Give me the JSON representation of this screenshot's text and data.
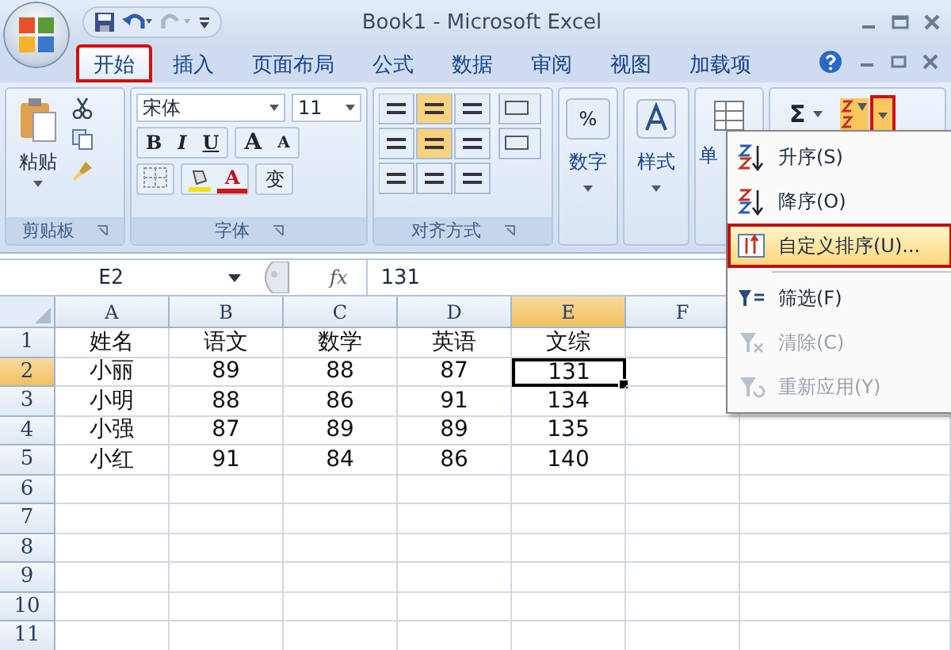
{
  "window": {
    "title": "Book1 - Microsoft Excel"
  },
  "tabs": [
    {
      "label": "开始",
      "selected": true,
      "marked": true
    },
    {
      "label": "插入",
      "selected": false,
      "marked": false
    },
    {
      "label": "页面布局",
      "selected": false,
      "marked": false
    },
    {
      "label": "公式",
      "selected": false,
      "marked": false
    },
    {
      "label": "数据",
      "selected": false,
      "marked": false
    },
    {
      "label": "审阅",
      "selected": false,
      "marked": false
    },
    {
      "label": "视图",
      "selected": false,
      "marked": false
    },
    {
      "label": "加载项",
      "selected": false,
      "marked": false
    }
  ],
  "ribbon": {
    "clipboard": {
      "label": "剪贴板",
      "paste": "粘贴"
    },
    "font": {
      "label": "字体",
      "font_name": "宋体",
      "font_size": "11",
      "bold": "B",
      "italic": "I",
      "underline": "U",
      "grow": "A",
      "shrink": "A",
      "phonetic": "变",
      "color_letter": "A"
    },
    "alignment": {
      "label": "对齐方式"
    },
    "number": {
      "label": "数字",
      "symbol": "%"
    },
    "styles": {
      "label": "样式"
    },
    "cells": {
      "label": "单"
    },
    "editing": {
      "sum": "Σ",
      "sort_marked": true
    }
  },
  "formula_bar": {
    "name_box": "E2",
    "fx": "fx",
    "value": "131"
  },
  "sheet": {
    "columns": [
      {
        "label": "A",
        "selected": false
      },
      {
        "label": "B",
        "selected": false
      },
      {
        "label": "C",
        "selected": false
      },
      {
        "label": "D",
        "selected": false
      },
      {
        "label": "E",
        "selected": true
      },
      {
        "label": "F",
        "selected": false
      }
    ],
    "rows": [
      {
        "number": "1",
        "selected": false,
        "cells": [
          "姓名",
          "语文",
          "数学",
          "英语",
          "文综"
        ]
      },
      {
        "number": "2",
        "selected": true,
        "cells": [
          "小丽",
          "89",
          "88",
          "87",
          "131"
        ]
      },
      {
        "number": "3",
        "selected": false,
        "cells": [
          "小明",
          "88",
          "86",
          "91",
          "134"
        ]
      },
      {
        "number": "4",
        "selected": false,
        "cells": [
          "小强",
          "87",
          "89",
          "89",
          "135"
        ]
      },
      {
        "number": "5",
        "selected": false,
        "cells": [
          "小红",
          "91",
          "84",
          "86",
          "140"
        ]
      },
      {
        "number": "6",
        "selected": false
      },
      {
        "number": "7",
        "selected": false
      },
      {
        "number": "8",
        "selected": false
      },
      {
        "number": "9",
        "selected": false
      },
      {
        "number": "10",
        "selected": false
      },
      {
        "number": "11",
        "selected": false
      }
    ]
  },
  "sort_menu": {
    "items": [
      {
        "kind": "asc",
        "label": "升序(S)",
        "selected": false,
        "marked": false,
        "disabled": false
      },
      {
        "kind": "desc",
        "label": "降序(O)",
        "selected": false,
        "marked": false,
        "disabled": false
      },
      {
        "kind": "custom",
        "label": "自定义排序(U)...",
        "selected": true,
        "marked": true,
        "disabled": false
      },
      {
        "kind": "separator"
      },
      {
        "kind": "filter",
        "label": "筛选(F)",
        "selected": false,
        "marked": false,
        "disabled": false
      },
      {
        "kind": "clear",
        "label": "清除(C)",
        "selected": false,
        "marked": false,
        "disabled": true
      },
      {
        "kind": "reapply",
        "label": "重新应用(Y)",
        "selected": false,
        "marked": false,
        "disabled": true
      }
    ]
  }
}
